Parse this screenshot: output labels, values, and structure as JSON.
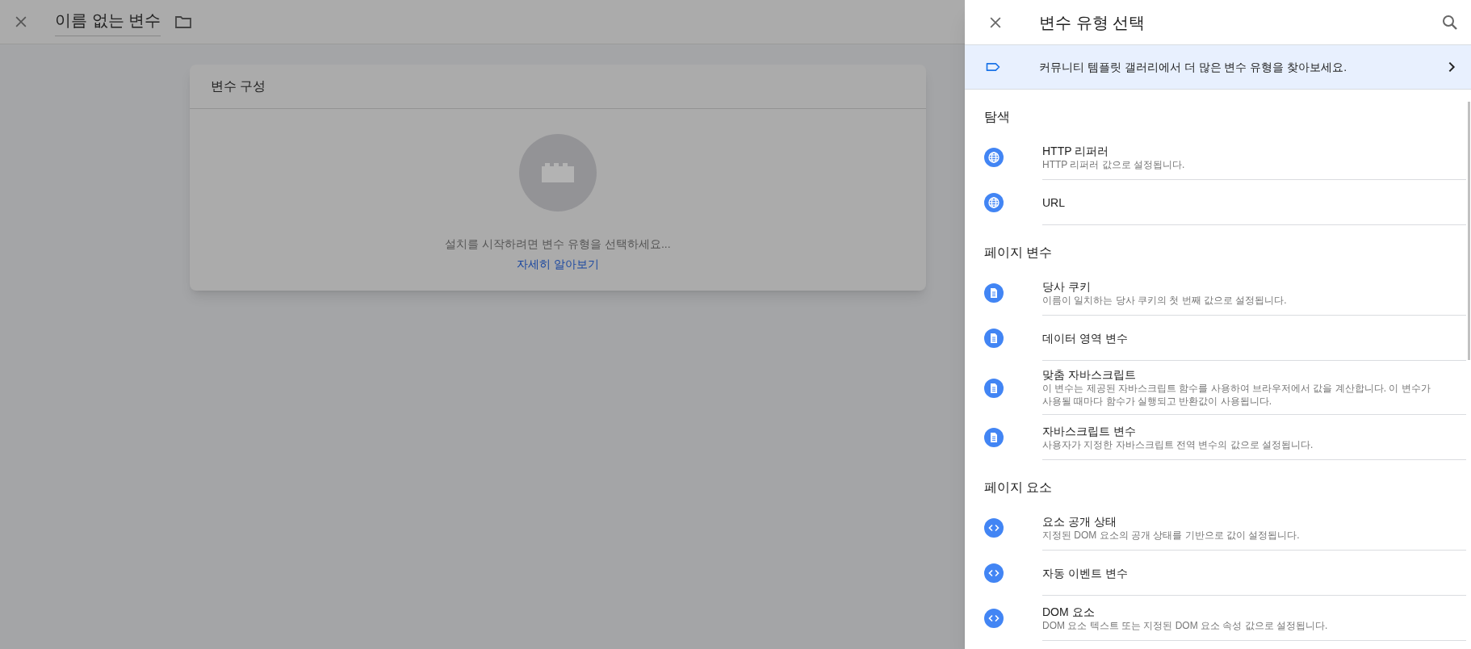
{
  "editor": {
    "title": "이름 없는 변수",
    "card": {
      "title": "변수 구성",
      "message": "설치를 시작하려면 변수 유형을 선택하세요...",
      "link": "자세히 알아보기"
    }
  },
  "panel": {
    "title": "변수 유형 선택",
    "banner": "커뮤니티 템플릿 갤러리에서 더 많은 변수 유형을 찾아보세요.",
    "sections": [
      {
        "heading": "탐색",
        "items": [
          {
            "kind": "globe",
            "title": "HTTP 리퍼러",
            "description": "HTTP 리퍼러 값으로 설정됩니다."
          },
          {
            "kind": "globe",
            "title": "URL"
          }
        ]
      },
      {
        "heading": "페이지 변수",
        "items": [
          {
            "kind": "document",
            "title": "당사 쿠키",
            "description": "이름이 일치하는 당사 쿠키의 첫 번째 값으로 설정됩니다."
          },
          {
            "kind": "document",
            "title": "데이터 영역 변수"
          },
          {
            "kind": "document",
            "title": "맞춤 자바스크립트",
            "description": "이 변수는 제공된 자바스크립트 함수를 사용하여 브라우저에서 값을 계산합니다. 이 변수가 사용될 때마다 함수가 실행되고 반환값이 사용됩니다."
          },
          {
            "kind": "document",
            "title": "자바스크립트 변수",
            "description": "사용자가 지정한 자바스크립트 전역 변수의 값으로 설정됩니다."
          }
        ]
      },
      {
        "heading": "페이지 요소",
        "items": [
          {
            "kind": "code",
            "title": "요소 공개 상태",
            "description": "지정된 DOM 요소의 공개 상태를 기반으로 값이 설정됩니다."
          },
          {
            "kind": "code",
            "title": "자동 이벤트 변수"
          },
          {
            "kind": "code",
            "title": "DOM 요소",
            "description": "DOM 요소 텍스트 또는 지정된 DOM 요소 속성 값으로 설정됩니다."
          }
        ]
      }
    ]
  }
}
